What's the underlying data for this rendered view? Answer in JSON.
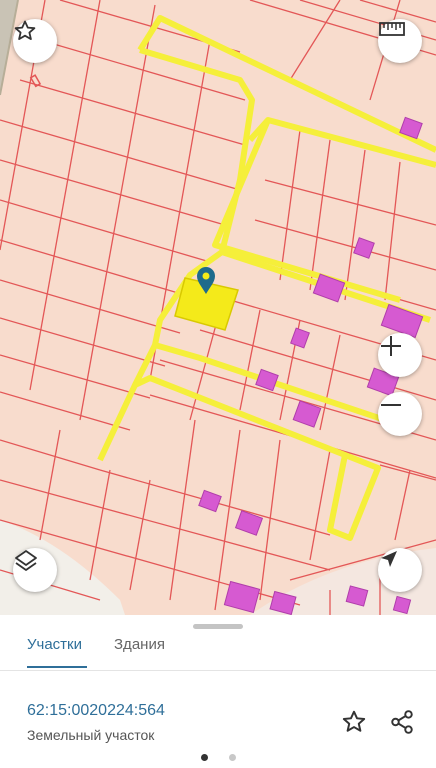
{
  "map": {
    "marker_icon": "location-pin-icon",
    "colors": {
      "background": "#f8dccd",
      "parcel_border": "#e35757",
      "selected_parcel": "#f4ea1a",
      "road_highlight": "#f5ef3a",
      "building": "#d65ad1",
      "marker": "#1e6b8c"
    }
  },
  "controls": {
    "favorite_icon": "star-outline-icon",
    "ruler_icon": "ruler-icon",
    "zoom_in_icon": "plus-icon",
    "zoom_out_icon": "minus-icon",
    "layers_icon": "layers-icon",
    "location_icon": "navigation-arrow-icon"
  },
  "sheet": {
    "tabs": [
      {
        "label": "Участки",
        "active": true
      },
      {
        "label": "Здания",
        "active": false
      }
    ],
    "cadastral_number": "62:15:0020224:564",
    "object_type": "Земельный участок",
    "favorite_icon": "star-outline-icon",
    "share_icon": "share-icon",
    "pager": {
      "pages": 2,
      "current": 1
    }
  }
}
